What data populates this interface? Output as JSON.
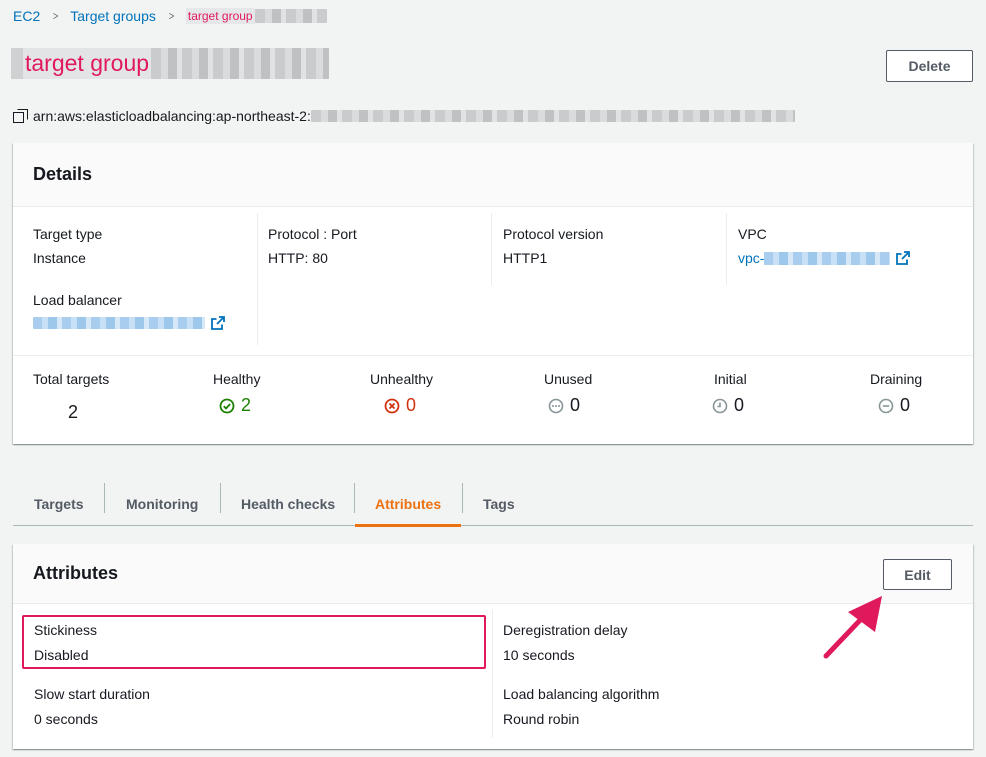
{
  "breadcrumb": {
    "items": [
      "EC2",
      "Target groups"
    ],
    "current": "target group",
    "separator": ">"
  },
  "page": {
    "title": "target group",
    "arn_prefix": "arn:aws:elasticloadbalancing:ap-northeast-2:",
    "delete_label": "Delete"
  },
  "details": {
    "title": "Details",
    "target_type_label": "Target type",
    "target_type_value": "Instance",
    "protocol_port_label": "Protocol : Port",
    "protocol_port_value": "HTTP: 80",
    "protocol_version_label": "Protocol version",
    "protocol_version_value": "HTTP1",
    "vpc_label": "VPC",
    "vpc_value_prefix": "vpc-",
    "load_balancer_label": "Load balancer"
  },
  "counts": {
    "total_label": "Total targets",
    "total_value": "2",
    "healthy_label": "Healthy",
    "healthy_value": "2",
    "unhealthy_label": "Unhealthy",
    "unhealthy_value": "0",
    "unused_label": "Unused",
    "unused_value": "0",
    "initial_label": "Initial",
    "initial_value": "0",
    "draining_label": "Draining",
    "draining_value": "0"
  },
  "tabs": [
    {
      "label": "Targets"
    },
    {
      "label": "Monitoring"
    },
    {
      "label": "Health checks"
    },
    {
      "label": "Attributes"
    },
    {
      "label": "Tags"
    }
  ],
  "active_tab": "Attributes",
  "attributes": {
    "title": "Attributes",
    "edit_label": "Edit",
    "stickiness_label": "Stickiness",
    "stickiness_value": "Disabled",
    "dereg_label": "Deregistration delay",
    "dereg_value": "10 seconds",
    "slow_start_label": "Slow start duration",
    "slow_start_value": "0 seconds",
    "lb_algo_label": "Load balancing algorithm",
    "lb_algo_value": "Round robin"
  },
  "colors": {
    "link": "#0073bb",
    "accent": "#ec7211",
    "highlight": "#e0195d",
    "healthy": "#1d8102",
    "unhealthy": "#d13212",
    "muted": "#687078"
  },
  "icons": {
    "copy": "copy-icon",
    "external": "external-link-icon",
    "healthy": "check-circle-icon",
    "unhealthy": "x-circle-icon",
    "unused": "ellipsis-circle-icon",
    "initial": "clock-icon",
    "draining": "minus-circle-icon"
  }
}
